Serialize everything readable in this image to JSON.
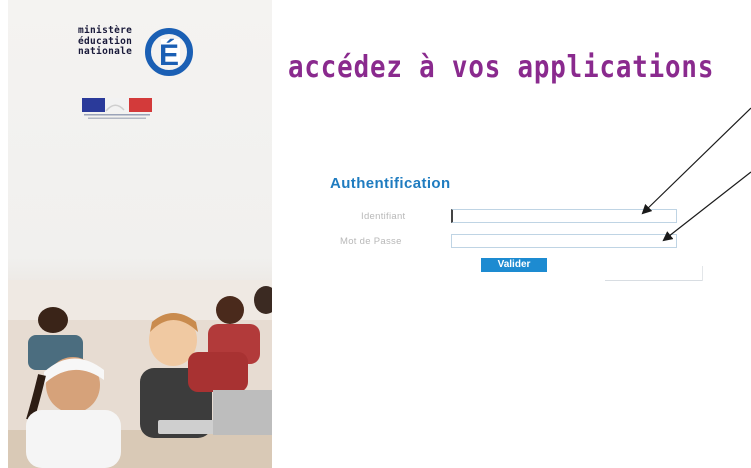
{
  "sidebar": {
    "logo_lines": [
      "ministère",
      "éducation",
      "nationale"
    ],
    "logo_letter": "É"
  },
  "main": {
    "headline": "accédez à vos applications",
    "auth_title": "Authentification",
    "id_label": "Identifiant",
    "password_label": "Mot de Passe",
    "id_value": "",
    "password_value": "",
    "submit_label": "Valider"
  },
  "colors": {
    "headline": "#8a2a8e",
    "auth_title": "#1f7cc0",
    "button": "#1d8bd1",
    "logo_blue": "#1a5fb4"
  }
}
